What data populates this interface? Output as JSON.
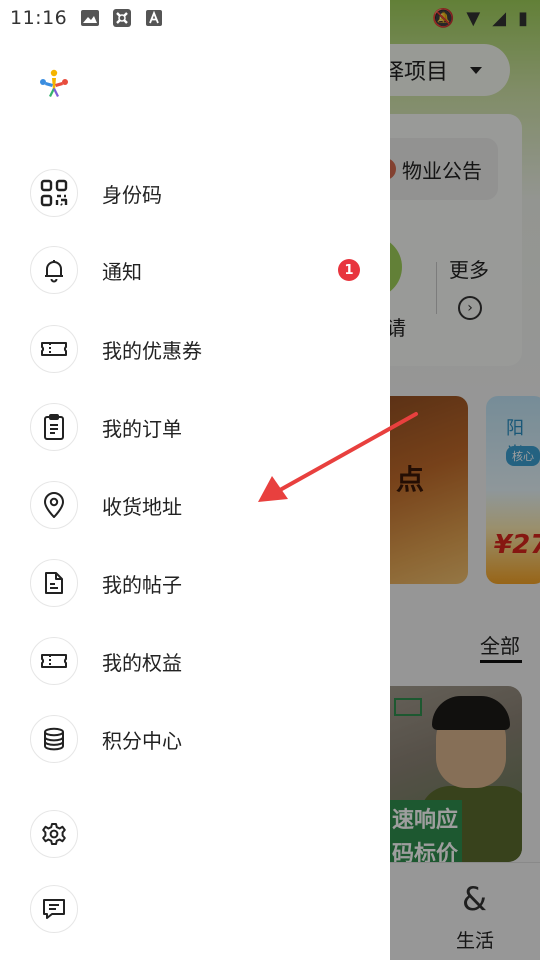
{
  "status_bar": {
    "time": "11:16"
  },
  "background": {
    "project_selector": "择项目",
    "notice": "物业公告",
    "apply": "请",
    "more": "更多",
    "promo1_text": "点",
    "promo2_title": "阳光",
    "promo2_tag": "核心",
    "promo2_price": "¥27",
    "tab_all": "全部",
    "feature_line1": "速响应",
    "feature_line2": "码标价",
    "nav_life": "生活"
  },
  "drawer": {
    "menu": [
      {
        "label": "身份码",
        "icon": "qr-code-icon"
      },
      {
        "label": "通知",
        "icon": "bell-icon",
        "badge": "1"
      },
      {
        "label": "我的优惠券",
        "icon": "ticket-icon"
      },
      {
        "label": "我的订单",
        "icon": "clipboard-icon"
      },
      {
        "label": "收货地址",
        "icon": "location-pin-icon"
      },
      {
        "label": "我的帖子",
        "icon": "document-icon"
      },
      {
        "label": "我的权益",
        "icon": "ticket-icon"
      },
      {
        "label": "积分中心",
        "icon": "coin-stack-icon"
      }
    ],
    "bottom_icons": [
      "settings-gear-icon",
      "chat-message-icon"
    ]
  },
  "colors": {
    "badge": "#e8353e",
    "annotation_arrow": "#e8403e",
    "brand_green": "#9fcf5a"
  }
}
